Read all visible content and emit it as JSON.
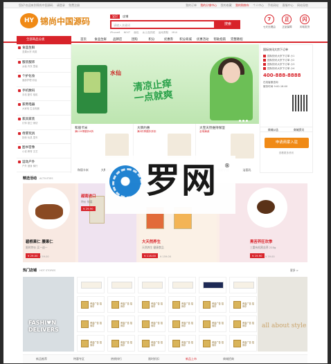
{
  "topbar": {
    "left": [
      "您好!欢迎来到锦尚中国源码",
      "请登录",
      "免费注册"
    ],
    "right": [
      "我的订单",
      "我的分销中心",
      "我的收藏",
      "我的购物车",
      "个人中心",
      "手机网站",
      "客服中心",
      "网站导航"
    ]
  },
  "logo": {
    "badge": "HY",
    "name": "锦尚中国源码"
  },
  "search": {
    "tabs": [
      "宝贝",
      "店铺"
    ],
    "placeholder": "请输入关键词",
    "button": "搜索",
    "hot": [
      "iPhone6",
      "NEXT",
      "面包",
      "女士连衣裙",
      "运动男鞋",
      "MIUI"
    ]
  },
  "services": [
    {
      "icon": "7",
      "label": "七天无理由"
    },
    {
      "icon": "正",
      "label": "正品保障"
    },
    {
      "icon": "闪",
      "label": "闪电发货"
    }
  ],
  "nav": {
    "category_label": "全部商品分类",
    "items": [
      "首页",
      "食品生鲜",
      "品牌店",
      "团购",
      "积分",
      "优惠券",
      "积分商城",
      "优惠活动",
      "帮助指南",
      "完整教程"
    ]
  },
  "sidebar": [
    {
      "title": "食品生鲜",
      "sub": "坚果炒货 肉类"
    },
    {
      "title": "服装服饰",
      "sub": "女装 内衣 童装"
    },
    {
      "title": "个护化妆",
      "sub": "面部护理 彩妆"
    },
    {
      "title": "手机数码",
      "sub": "手机 配件 相机"
    },
    {
      "title": "家用电器",
      "sub": "大家电 生活电器"
    },
    {
      "title": "家具家装",
      "sub": "灯饰 厨卫 家纺"
    },
    {
      "title": "母婴玩具",
      "sub": "奶粉 玩具 童车"
    },
    {
      "title": "图书音像",
      "sub": "小说 教育 文艺"
    },
    {
      "title": "运动户外",
      "sub": "户外 健身 骑行"
    }
  ],
  "banner": {
    "brand": "水仙",
    "slogan_1": "清凉止痒",
    "slogan_2": "一点就爽"
  },
  "promos": [
    {
      "title": "和丽卡米",
      "sub": "满119享额外8折"
    },
    {
      "title": "大牌约惠",
      "sub": "满3件享额外折扣"
    },
    {
      "title": "大宝天然维持保湿",
      "sub": "全场满减"
    }
  ],
  "promo_nav": [
    "和丽卡米",
    "大牌约惠",
    "大宝天然",
    "润肤精华",
    "清爽防晒",
    "美白面膜",
    "眼部护理",
    "洁面乳"
  ],
  "right_panel": {
    "header": "国际快讯大宗下订单",
    "news": [
      "国际快讯大宗下订单 小1",
      "国际快讯大宗下订单 小2",
      "国际快讯大宗下订单 小3",
      "国际快讯大宗下订单 小4"
    ],
    "phone": "400-888-8888",
    "links": [
      "在线客服咨询",
      "服务时间 9:00-18:00"
    ],
    "tabs": [
      "商城公告",
      "商城资讯"
    ],
    "join_label": "申请商家入驻",
    "more": "查看更多资讯"
  },
  "activity": {
    "title": "精选活动",
    "subtitle": "ACTIVITIES"
  },
  "deals": [
    {
      "title": "碧根果仁 腰果仁",
      "sub": "限时特价 买一送一",
      "price": "¥ 29.00",
      "old": "¥ 59.00"
    },
    {
      "title": "越南进口",
      "sub": "特价 惊喜",
      "price": "¥ 29.90",
      "old": ""
    },
    {
      "title": "大天然养生",
      "sub": "天然养生 健康食品",
      "price": "¥ 118.00",
      "old": "¥ 159.00"
    },
    {
      "title": "黑苦荞狂欢季",
      "sub": "三重有机黑苦荞 210g",
      "price": "¥ 19.90",
      "old": "¥ 39.00"
    }
  ],
  "shops": {
    "title": "热门店铺",
    "subtitle": "HOT STORES",
    "more": "更多 >",
    "left_text": "FASHI♥N DELIVERS",
    "right_text": "all about style",
    "cell_label": "黄金广告 招商中",
    "brands": [
      "女装",
      "特卖",
      "潮流",
      "伊衣",
      "IMPRESS",
      "女鞋"
    ]
  },
  "footer_tabs": [
    "新品推荐",
    "特惠专区",
    "热销排行",
    "限时折扣",
    "新品上市",
    "商城招商"
  ],
  "watermark": {
    "text": "罗网",
    "mark": "®"
  }
}
